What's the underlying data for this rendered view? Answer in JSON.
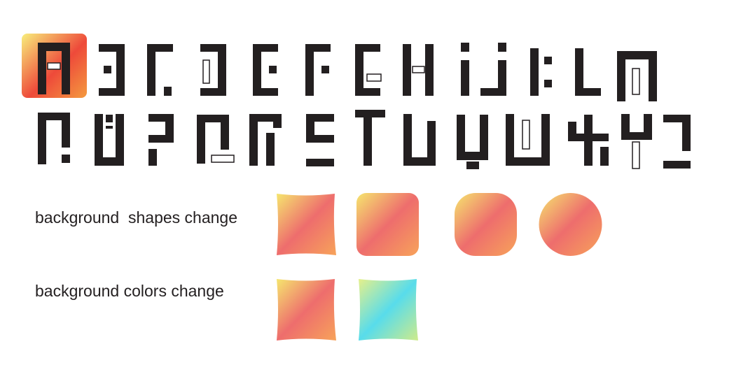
{
  "rows": {
    "shapes_label": "background  shapes change",
    "colors_label": "background colors change"
  },
  "colors": {
    "ink": "#231f20",
    "warm_gradient": [
      "#f5e66e",
      "#ee6d6d",
      "#f7a35a"
    ],
    "warm_gradient_highlight": [
      "#f8ef7c",
      "#ee4a3a",
      "#f49a3f"
    ],
    "cool_gradient": [
      "#e6f08a",
      "#58dceb",
      "#cfeb8a"
    ]
  },
  "swatch_shapes": [
    "pinched-square",
    "soft-rounded-square",
    "rounded-square",
    "circle"
  ],
  "glyph_rows": 2,
  "glyph_count": 26
}
